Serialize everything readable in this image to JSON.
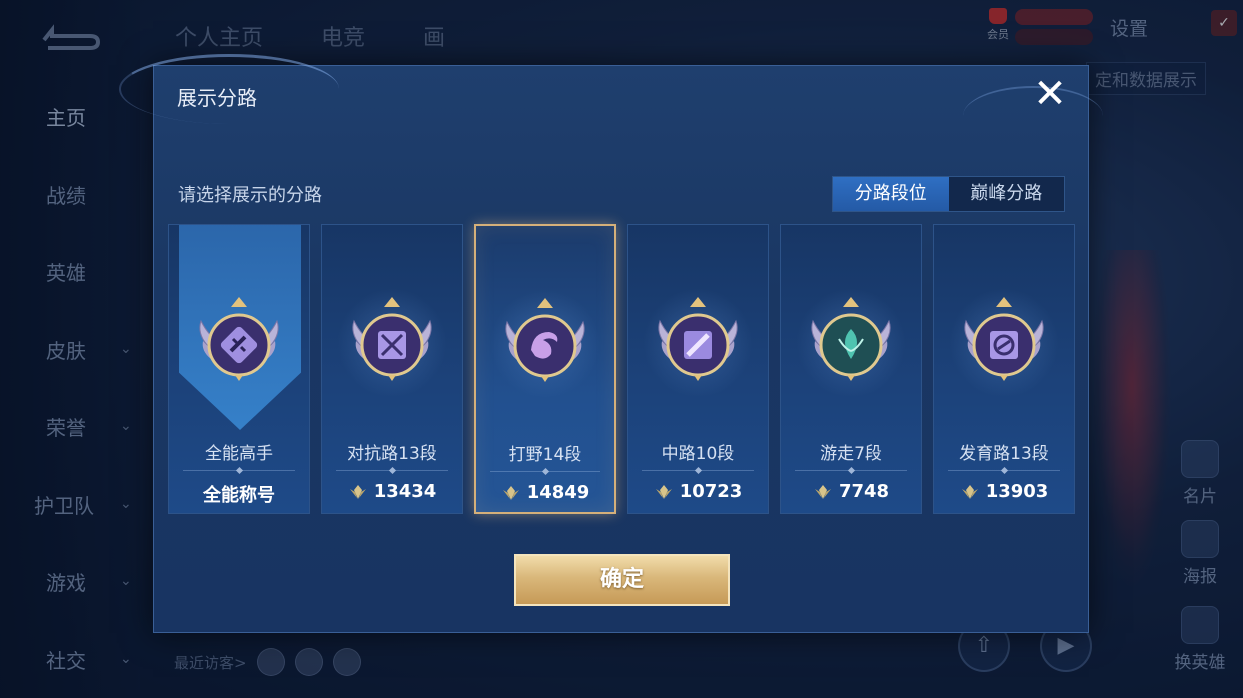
{
  "background": {
    "sidebar": [
      {
        "label": "主页",
        "has_chevron": false,
        "active": true
      },
      {
        "label": "战绩",
        "has_chevron": false
      },
      {
        "label": "英雄",
        "has_chevron": false
      },
      {
        "label": "皮肤",
        "has_chevron": true
      },
      {
        "label": "荣誉",
        "has_chevron": true
      },
      {
        "label": "护卫队",
        "has_chevron": true
      },
      {
        "label": "游戏",
        "has_chevron": true
      },
      {
        "label": "社交",
        "has_chevron": true
      }
    ],
    "top_tabs": [
      "个人主页",
      "电竞",
      "画"
    ],
    "member_label": "会员",
    "settings_label": "设置",
    "data_display_label": "定和数据展示",
    "right_tools": [
      "名片",
      "海报",
      "换英雄"
    ],
    "recent_visitors_label": "最近访客>"
  },
  "modal": {
    "title": "展示分路",
    "prompt": "请选择展示的分路",
    "segment": {
      "options": [
        "分路段位",
        "巅峰分路"
      ],
      "selected": 0
    },
    "cards": [
      {
        "name": "全能高手",
        "value": "全能称号",
        "selected": false,
        "emblem": "all-round-emblem",
        "accent": "#9f8fe0",
        "show_gem": false,
        "banner": true
      },
      {
        "name": "对抗路13段",
        "value": "13434",
        "selected": false,
        "emblem": "clash-lane-emblem",
        "accent": "#a897e6",
        "show_gem": true
      },
      {
        "name": "打野14段",
        "value": "14849",
        "selected": true,
        "emblem": "jungle-emblem",
        "accent": "#c8a0e8",
        "show_gem": true
      },
      {
        "name": "中路10段",
        "value": "10723",
        "selected": false,
        "emblem": "mid-lane-emblem",
        "accent": "#9b8ae0",
        "show_gem": true
      },
      {
        "name": "游走7段",
        "value": "7748",
        "selected": false,
        "emblem": "roam-emblem",
        "accent": "#4fc3b0",
        "show_gem": true
      },
      {
        "name": "发育路13段",
        "value": "13903",
        "selected": false,
        "emblem": "farm-lane-emblem",
        "accent": "#a897e6",
        "show_gem": true
      }
    ],
    "confirm_label": "确定"
  },
  "colors": {
    "gold": "#d9b77a",
    "panel": "#1a3763",
    "segment_active": "#2f6fc3"
  }
}
